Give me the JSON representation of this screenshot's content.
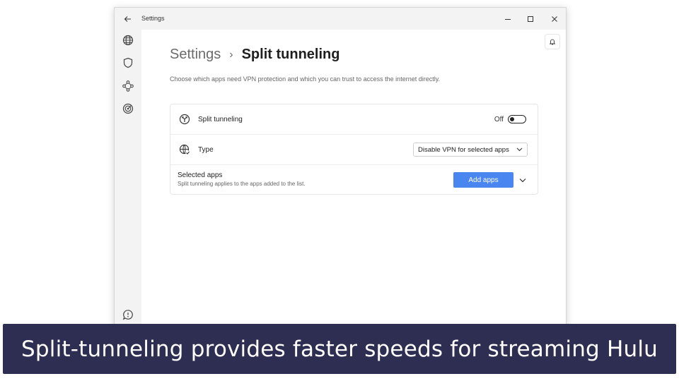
{
  "window": {
    "title": "Settings"
  },
  "sidebar": {
    "items": [
      {
        "icon": "globe-icon"
      },
      {
        "icon": "shield-icon"
      },
      {
        "icon": "mesh-network-icon"
      },
      {
        "icon": "target-icon"
      },
      {
        "icon": "support-chat-icon"
      }
    ]
  },
  "header": {
    "breadcrumb_root": "Settings",
    "breadcrumb_separator": "›",
    "breadcrumb_current": "Split tunneling",
    "subtitle": "Choose which apps need VPN protection and which you can trust to access the internet directly."
  },
  "split_tunneling": {
    "label": "Split tunneling",
    "state_label": "Off",
    "enabled": false
  },
  "type": {
    "label": "Type",
    "selected_option": "Disable VPN for selected apps"
  },
  "selected_apps": {
    "title": "Selected apps",
    "description": "Split tunneling applies to the apps added to the list.",
    "button_label": "Add apps"
  },
  "caption": {
    "text": "Split-tunneling provides faster speeds for streaming Hulu"
  },
  "colors": {
    "accent": "#4a86f0",
    "caption_bg": "#2e2e52",
    "sidebar_bg": "#f3f3f3"
  }
}
